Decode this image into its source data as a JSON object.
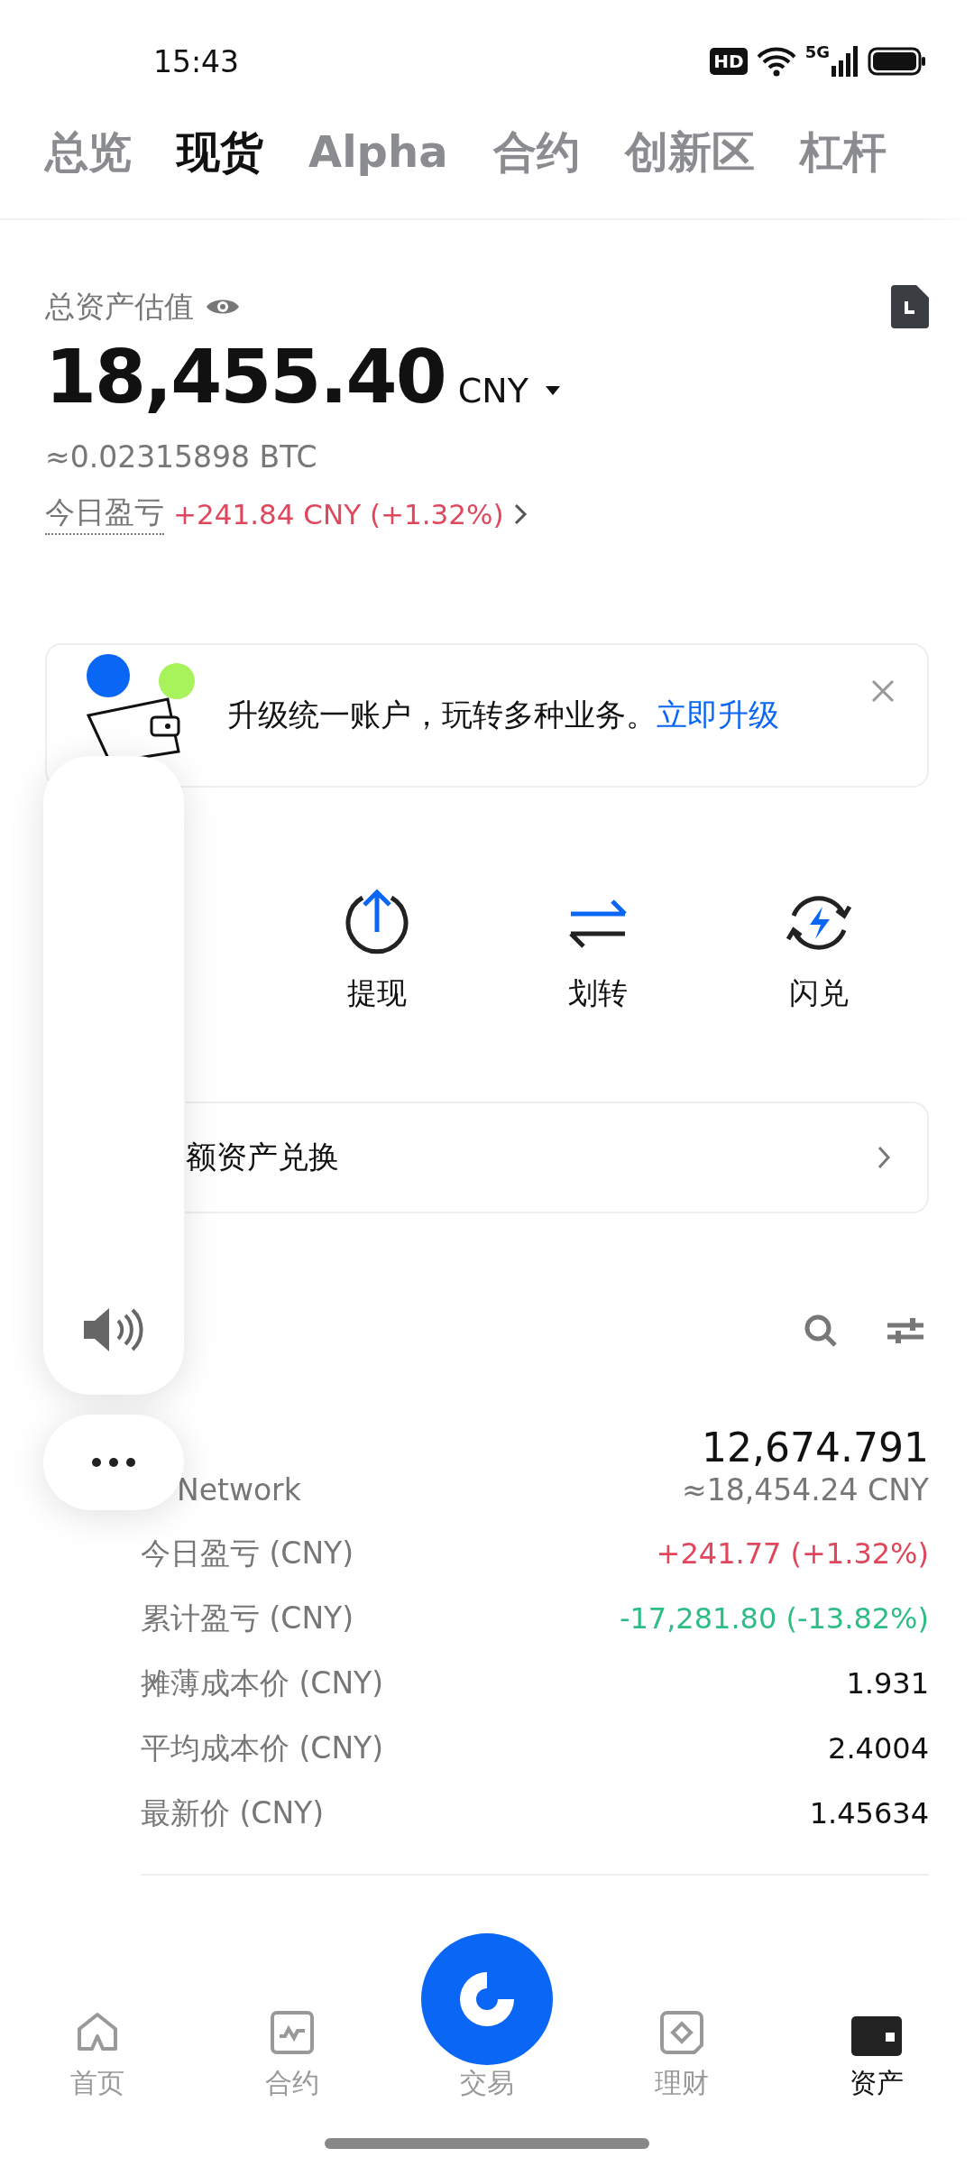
{
  "status_bar": {
    "time": "15:43",
    "hd_badge": "HD",
    "network": "5G"
  },
  "tabs": [
    {
      "label": "总览",
      "selected": false
    },
    {
      "label": "现货",
      "selected": true
    },
    {
      "label": "Alpha",
      "selected": false
    },
    {
      "label": "合约",
      "selected": false
    },
    {
      "label": "创新区",
      "selected": false
    },
    {
      "label": "杠杆",
      "selected": false
    }
  ],
  "summary": {
    "label": "总资产估值",
    "total": "18,455.40",
    "currency": "CNY",
    "btc": "≈0.02315898 BTC",
    "pnl_label": "今日盈亏",
    "pnl": "+241.84 CNY (+1.32%)"
  },
  "banner": {
    "text": "升级统一账户，玩转多种业务。",
    "link": "立即升级"
  },
  "actions": [
    {
      "kind": "withdraw",
      "label": "提现"
    },
    {
      "kind": "transfer",
      "label": "划转"
    },
    {
      "kind": "convert",
      "label": "闪兑"
    }
  ],
  "convert_row": {
    "label": "额资产兑换"
  },
  "asset": {
    "name": "Network",
    "amount": "12,674.791",
    "value": "≈18,454.24 CNY",
    "rows": [
      {
        "label": "今日盈亏 (CNY)",
        "value": "+241.77 (+1.32%)",
        "color": "#e0475c"
      },
      {
        "label": "累计盈亏 (CNY)",
        "value": "-17,281.80 (-13.82%)",
        "color": "#2ebd85"
      },
      {
        "label": "摊薄成本价 (CNY)",
        "value": "1.931",
        "color": "#111111"
      },
      {
        "label": "平均成本价 (CNY)",
        "value": "2.4004",
        "color": "#111111"
      },
      {
        "label": "最新价 (CNY)",
        "value": "1.45634",
        "color": "#111111"
      }
    ]
  },
  "nav": [
    {
      "kind": "home",
      "label": "首页",
      "selected": false
    },
    {
      "kind": "futures",
      "label": "合约",
      "selected": false
    },
    {
      "kind": "trade",
      "label": "交易",
      "selected": false
    },
    {
      "kind": "earn",
      "label": "理财",
      "selected": false
    },
    {
      "kind": "assets",
      "label": "资产",
      "selected": true
    }
  ]
}
